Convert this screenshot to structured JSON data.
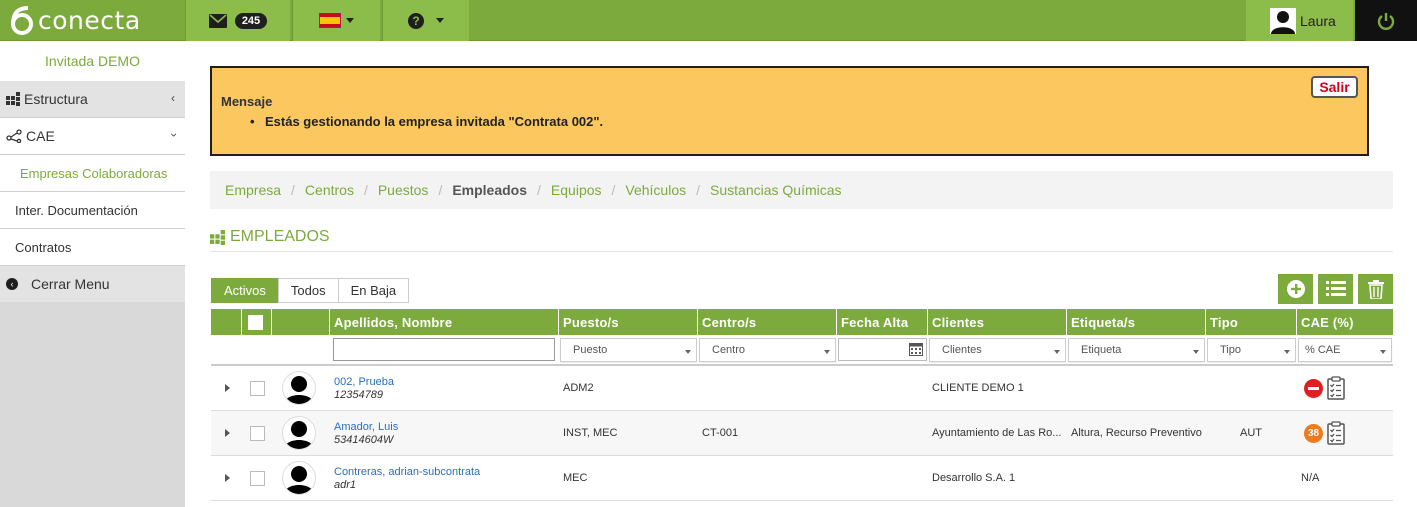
{
  "app": {
    "logo_text": "conecta"
  },
  "topbar": {
    "mail_count": "245",
    "user_name": "Laura"
  },
  "sidebar": {
    "invited": "Invitada DEMO",
    "items": [
      {
        "label": "Estructura"
      },
      {
        "label": "CAE"
      }
    ],
    "subitems": [
      {
        "label": "Empresas Colaboradoras"
      },
      {
        "label": "Inter. Documentación"
      },
      {
        "label": "Contratos"
      }
    ],
    "close_label": "Cerrar Menu"
  },
  "message": {
    "title": "Mensaje",
    "item": "Estás gestionando la empresa invitada \"Contrata 002\".",
    "exit_label": "Salir"
  },
  "nav": {
    "links": [
      "Empresa",
      "Centros",
      "Puestos",
      "Empleados",
      "Equipos",
      "Vehículos",
      "Sustancias Químicas"
    ],
    "current": "Empleados"
  },
  "section_title": "EMPLEADOS",
  "tabs": [
    "Activos",
    "Todos",
    "En Baja"
  ],
  "active_tab": "Activos",
  "table": {
    "headers": {
      "name": "Apellidos, Nombre",
      "puesto": "Puesto/s",
      "centro": "Centro/s",
      "fecha": "Fecha Alta",
      "clientes": "Clientes",
      "etiqueta": "Etiqueta/s",
      "tipo": "Tipo",
      "cae": "CAE (%)"
    },
    "filters": {
      "puesto": "Puesto",
      "centro": "Centro",
      "clientes": "Clientes",
      "etiqueta": "Etiqueta",
      "tipo": "Tipo",
      "cae": "% CAE"
    },
    "rows": [
      {
        "name": "002, Prueba",
        "doc": "12354789",
        "puesto": "ADM2",
        "centro": "",
        "clientes": "CLIENTE DEMO 1",
        "etiqueta": "",
        "tipo": "",
        "cae": "blocked"
      },
      {
        "name": "Amador, Luis",
        "doc": "53414604W",
        "puesto": "INST, MEC",
        "centro": "CT-001",
        "clientes": "Ayuntamiento de Las Ro...",
        "etiqueta": "Altura, Recurso Preventivo",
        "tipo": "AUT",
        "cae": "38"
      },
      {
        "name": "Contreras, adrian-subcontrata",
        "doc": "adr1",
        "puesto": "MEC",
        "centro": "",
        "clientes": "Desarrollo S.A. 1",
        "etiqueta": "",
        "tipo": "",
        "cae": "N/A"
      }
    ]
  },
  "colors": {
    "primary": "#7caa3c",
    "message_bg": "#fbc75e",
    "exit": "#d9001b",
    "cae_warning": "#f07b1b",
    "cae_blocked": "#e02020",
    "link": "#2a6ebd"
  }
}
